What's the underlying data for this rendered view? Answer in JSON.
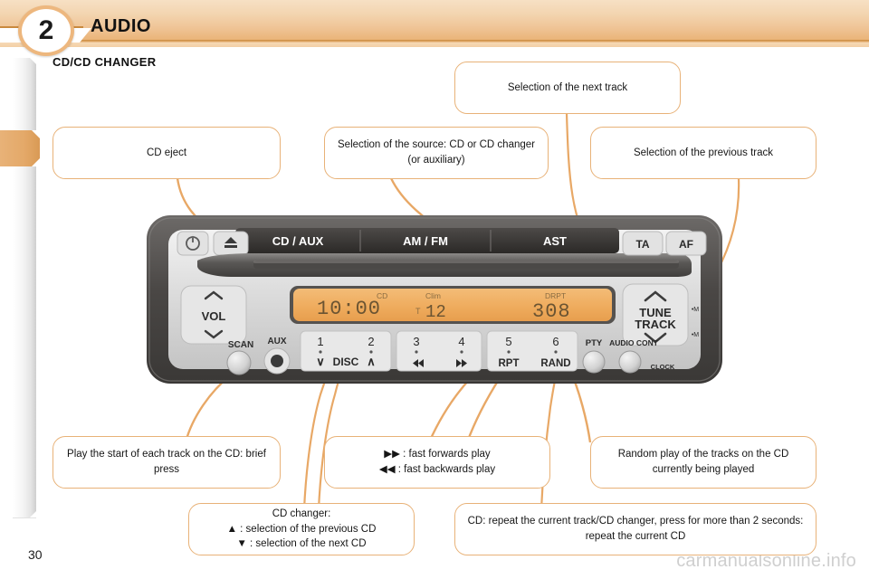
{
  "header": {
    "chapter_number": "2",
    "title": "AUDIO"
  },
  "section": {
    "title": "CD/CD CHANGER"
  },
  "sidebar": {
    "segment_count": 12,
    "active_index": 2,
    "active_color": "#e8b278"
  },
  "callouts": [
    {
      "id": "cd-eject",
      "text": "CD eject"
    },
    {
      "id": "source-select",
      "text": "Selection of the source: CD or CD changer (or auxiliary)"
    },
    {
      "id": "next-track",
      "text": "Selection of the next track"
    },
    {
      "id": "previous-track",
      "text": "Selection of the previous track"
    },
    {
      "id": "scan",
      "text": "Play the start of each track on the CD: brief press"
    },
    {
      "id": "cd-changer",
      "line1": "CD changer:",
      "line2": "▲ : selection of the previous CD",
      "line3": "▼ : selection of the next CD"
    },
    {
      "id": "fast-play",
      "line1": "▶▶ : fast forwards play",
      "line2": "◀◀ : fast backwards play"
    },
    {
      "id": "random",
      "text": "Random play of the tracks on the CD currently being played"
    },
    {
      "id": "repeat",
      "text": "CD: repeat the current track/CD changer, press for more than 2 seconds: repeat the current CD"
    }
  ],
  "radio": {
    "top_buttons": [
      "CD / AUX",
      "AM / FM",
      "AST"
    ],
    "ta_label": "TA",
    "af_label": "AF",
    "vol_label": "VOL",
    "scan_label": "SCAN",
    "aux_label": "AUX",
    "disc_label": "DISC",
    "tune_label": "TUNE",
    "track_label": "TRACK",
    "tune_up_hint": "•M",
    "tune_down_hint": "•M",
    "pty_label": "PTY",
    "audio_cont_label": "AUDIO CONT",
    "clock_label": "CLOCK",
    "presets": [
      {
        "number": "1",
        "sub": "∨"
      },
      {
        "number": "2",
        "sub": "∧"
      },
      {
        "number": "3",
        "sub": "◀◀"
      },
      {
        "number": "4",
        "sub": "▶▶"
      },
      {
        "number": "5",
        "sub": "RPT"
      },
      {
        "number": "6",
        "sub": "RAND"
      }
    ],
    "display": {
      "clock": "10:00",
      "cd_indicator": "CD",
      "clim_label": "Clim",
      "temp_prefix": "T",
      "temp_value": "12",
      "drpt_label": "DRPT",
      "channel": "308",
      "backlight_color": "#f0b060"
    }
  },
  "footer": {
    "page_number": "30",
    "watermark": "carmanualsonline.info"
  }
}
